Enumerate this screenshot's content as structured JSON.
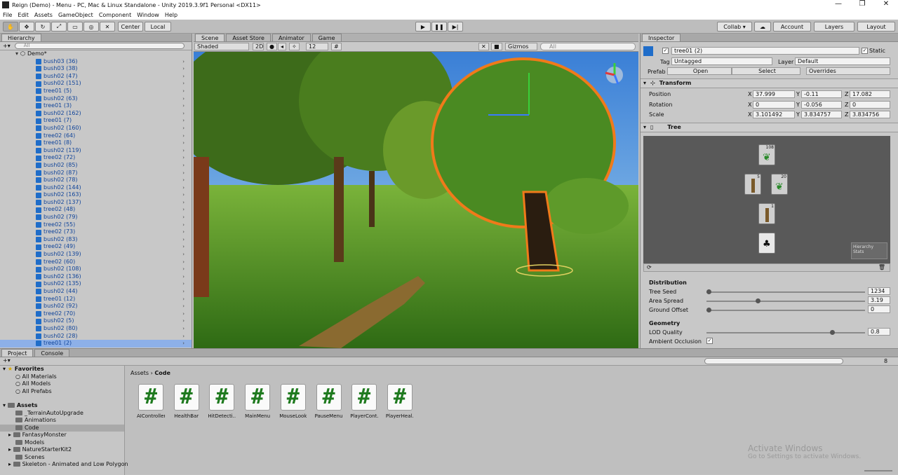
{
  "window": {
    "title": "Reign (Demo) - Menu - PC, Mac & Linux Standalone - Unity 2019.3.9f1 Personal <DX11>",
    "min": "—",
    "max": "❐",
    "close": "✕"
  },
  "menu": [
    "File",
    "Edit",
    "Assets",
    "GameObject",
    "Component",
    "Window",
    "Help"
  ],
  "toolbar": {
    "center": "Center",
    "local": "Local",
    "collab": "Collab ▾",
    "account": "Account",
    "layers": "Layers",
    "layout": "Layout"
  },
  "hierarchy": {
    "tab": "Hierarchy",
    "search_placeholder": "All",
    "root": "Demo*",
    "items": [
      "bush03 (36)",
      "bush03 (38)",
      "bush02 (47)",
      "bush02 (151)",
      "tree01 (5)",
      "bush02 (63)",
      "tree01 (3)",
      "bush02 (162)",
      "tree01 (7)",
      "bush02 (160)",
      "tree02 (64)",
      "tree01 (8)",
      "bush02 (119)",
      "tree02 (72)",
      "bush02 (85)",
      "bush02 (87)",
      "bush02 (78)",
      "bush02 (144)",
      "bush02 (163)",
      "bush02 (137)",
      "tree02 (48)",
      "bush02 (79)",
      "tree02 (55)",
      "tree02 (73)",
      "bush02 (83)",
      "tree02 (49)",
      "bush02 (139)",
      "tree02 (60)",
      "bush02 (108)",
      "bush02 (136)",
      "bush02 (135)",
      "bush02 (44)",
      "tree01 (12)",
      "bush02 (92)",
      "tree02 (70)",
      "bush02 (5)",
      "bush02 (80)",
      "bush02 (28)",
      "tree01 (2)"
    ],
    "selected": "tree01 (2)"
  },
  "scene": {
    "tabs": [
      "Scene",
      "Asset Store",
      "Animator",
      "Game"
    ],
    "shading": "Shaded",
    "mode2d": "2D",
    "layers_count": "12",
    "gizmos": "Gizmos",
    "search_placeholder": "All"
  },
  "inspector": {
    "tab": "Inspector",
    "object_name": "tree01 (2)",
    "static_label": "Static",
    "tag_label": "Tag",
    "tag": "Untagged",
    "layer_label": "Layer",
    "layer": "Default",
    "prefab_label": "Prefab",
    "open": "Open",
    "select": "Select",
    "overrides": "Overrides",
    "transform_title": "Transform",
    "position_label": "Position",
    "rotation_label": "Rotation",
    "scale_label": "Scale",
    "x": "X",
    "y": "Y",
    "z": "Z",
    "position": {
      "x": "37.999",
      "y": "-0.11",
      "z": "17.082"
    },
    "rotation": {
      "x": "0",
      "y": "-0.056",
      "z": "0"
    },
    "scale": {
      "x": "3.101492",
      "y": "3.834757",
      "z": "3.834756"
    },
    "tree_title": "Tree",
    "graph": {
      "leaves_top": "108",
      "branch_left": "5",
      "leaves_right": "20",
      "trunk": "1"
    },
    "hierarchy_stats": "Hierarchy Stats",
    "distribution_title": "Distribution",
    "tree_seed_label": "Tree Seed",
    "tree_seed": "1234",
    "area_spread_label": "Area Spread",
    "area_spread": "3.19",
    "ground_offset_label": "Ground Offset",
    "ground_offset": "0",
    "geometry_title": "Geometry",
    "lod_quality_label": "LOD Quality",
    "lod_quality": "0.8",
    "ambient_occlusion_label": "Ambient Occlusion"
  },
  "project": {
    "tabs": [
      "Project",
      "Console"
    ],
    "favorites_label": "Favorites",
    "favorites": [
      "All Materials",
      "All Models",
      "All Prefabs"
    ],
    "assets_label": "Assets",
    "folders": [
      "_TerrainAutoUpgrade",
      "Animations",
      "Code",
      "FantasyMonster",
      "Models",
      "NatureStarterKit2",
      "Scenes",
      "Skeleton - Animated and Low Polygon"
    ],
    "breadcrumb_root": "Assets",
    "breadcrumb_sep": "›",
    "breadcrumb_current": "Code",
    "scripts": [
      "AIController",
      "HealthBar",
      "HitDetecti...",
      "MainMenu",
      "MouseLook",
      "PauseMenu",
      "PlayerCont...",
      "PlayerHeal..."
    ],
    "script_glyph": "#",
    "hidden_count": "8"
  },
  "watermark": {
    "line1": "Activate Windows",
    "line2": "Go to Settings to activate Windows."
  }
}
